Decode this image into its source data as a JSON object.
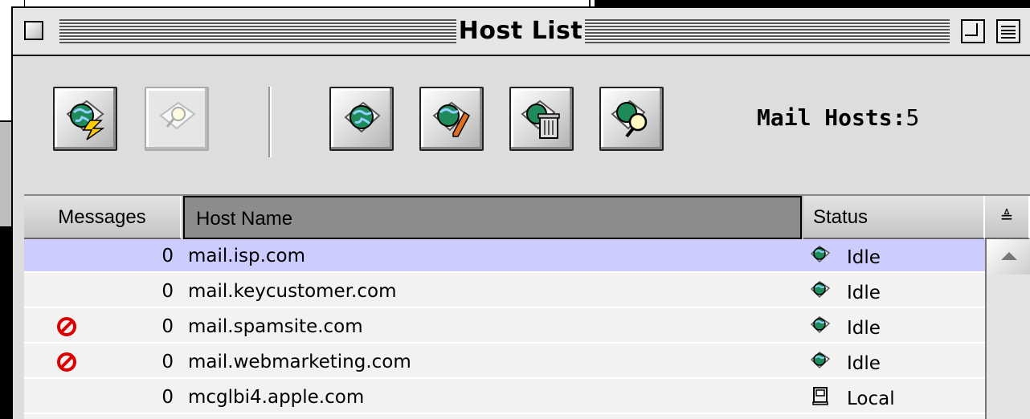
{
  "window": {
    "title": "Host List"
  },
  "toolbar": {
    "buttons": [
      {
        "icon": "connect-globe-lightning-icon",
        "enabled": true
      },
      {
        "icon": "find-magnifier-icon",
        "enabled": false
      },
      {
        "icon": "globe-host-icon",
        "enabled": true
      },
      {
        "icon": "edit-host-pencil-icon",
        "enabled": true
      },
      {
        "icon": "delete-host-trash-icon",
        "enabled": true
      },
      {
        "icon": "search-host-magnifier-icon",
        "enabled": true
      }
    ],
    "mail_hosts_label": "Mail Hosts:",
    "mail_hosts_count": "5"
  },
  "columns": {
    "messages": "Messages",
    "host_name": "Host Name",
    "status": "Status",
    "sort_glyph": "≜"
  },
  "rows": [
    {
      "blocked": false,
      "count": "0",
      "host": "mail.isp.com",
      "status": "Idle",
      "status_icon": "globe-status-icon",
      "selected": true
    },
    {
      "blocked": false,
      "count": "0",
      "host": "mail.keycustomer.com",
      "status": "Idle",
      "status_icon": "globe-status-icon",
      "selected": false
    },
    {
      "blocked": true,
      "count": "0",
      "host": "mail.spamsite.com",
      "status": "Idle",
      "status_icon": "globe-status-icon",
      "selected": false
    },
    {
      "blocked": true,
      "count": "0",
      "host": "mail.webmarketing.com",
      "status": "Idle",
      "status_icon": "globe-status-icon",
      "selected": false
    },
    {
      "blocked": false,
      "count": "0",
      "host": "mcglbi4.apple.com",
      "status": "Local",
      "status_icon": "computer-status-icon",
      "selected": false
    }
  ],
  "colors": {
    "selected_row": "#ccccff",
    "blocked_icon": "#dd0000",
    "globe": "#1f8a5a"
  }
}
